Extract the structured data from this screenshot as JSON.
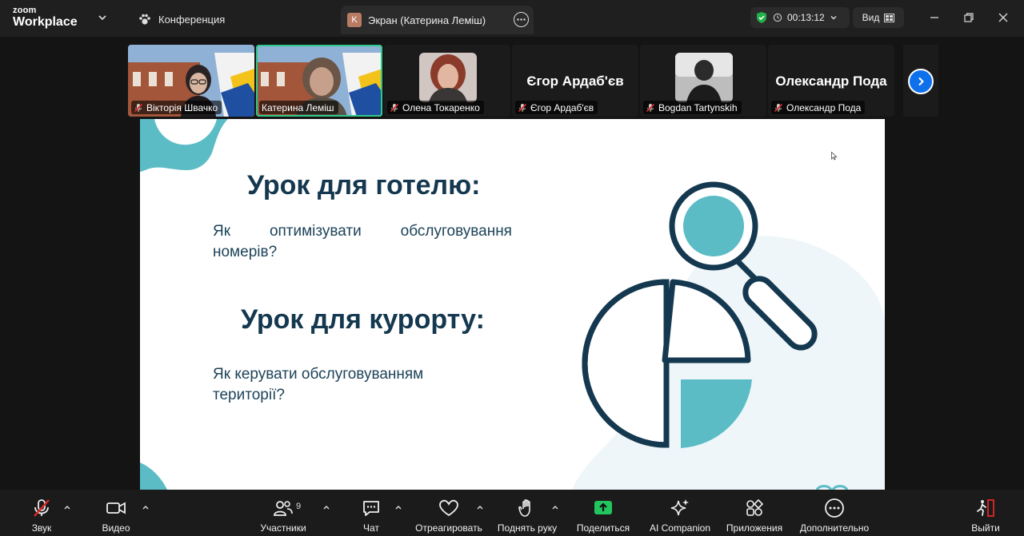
{
  "titlebar": {
    "brand_line1": "zoom",
    "brand_line2": "Workplace",
    "meeting_label": "Конференция",
    "tab_initial": "K",
    "tab_label": "Экран (Катерина Леміш)",
    "timer": "00:13:12",
    "view_label": "Вид"
  },
  "participants": [
    {
      "name": "Вікторія Швачко",
      "type": "video"
    },
    {
      "name": "Катерина Леміш",
      "type": "video",
      "active": true
    },
    {
      "name": "Олена Токаренко",
      "type": "photo"
    },
    {
      "name": "Єгор Ардаб'єв",
      "type": "text",
      "display": "Єгор Ардаб'єв"
    },
    {
      "name": "Bogdan Tartynskih",
      "type": "photo"
    },
    {
      "name": "Олександр Пода",
      "type": "text",
      "display": "Олександр Пода"
    }
  ],
  "slide": {
    "heading1": "Урок для готелю:",
    "para1_line1_words": [
      "Як",
      "оптимізувати",
      "обслуговування"
    ],
    "para1_line2": "номерів?",
    "heading2": "Урок для курорту:",
    "para2_line1": "Як керувати обслуговуванням",
    "para2_line2": "території?",
    "colors": {
      "dark": "#14384f",
      "teal": "#5bbcc6",
      "light": "#eef6f9"
    }
  },
  "toolbar": {
    "audio": "Звук",
    "video": "Видео",
    "participants": "Участники",
    "participants_count": "9",
    "chat": "Чат",
    "react": "Отреагировать",
    "raise_hand": "Поднять руку",
    "share": "Поделиться",
    "ai": "AI Companion",
    "apps": "Приложения",
    "more": "Дополнительно",
    "leave": "Выйти"
  }
}
